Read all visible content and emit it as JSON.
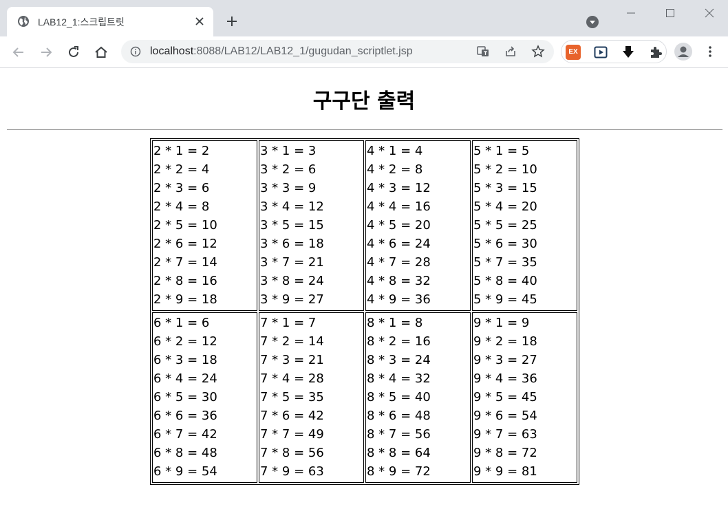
{
  "browser": {
    "tab_title": "LAB12_1:스크립트릿",
    "url_host": "localhost",
    "url_rest": ":8088/LAB12/LAB12_1/gugudan_scriptlet.jsp",
    "extension_badge": "EX"
  },
  "page": {
    "title": "구구단 출력"
  },
  "table": {
    "rows": [
      [
        [
          "2 * 1 = 2",
          "2 * 2 = 4",
          "2 * 3 = 6",
          "2 * 4 = 8",
          "2 * 5 = 10",
          "2 * 6 = 12",
          "2 * 7 = 14",
          "2 * 8 = 16",
          "2 * 9 = 18"
        ],
        [
          "3 * 1 = 3",
          "3 * 2 = 6",
          "3 * 3 = 9",
          "3 * 4 = 12",
          "3 * 5 = 15",
          "3 * 6 = 18",
          "3 * 7 = 21",
          "3 * 8 = 24",
          "3 * 9 = 27"
        ],
        [
          "4 * 1 = 4",
          "4 * 2 = 8",
          "4 * 3 = 12",
          "4 * 4 = 16",
          "4 * 5 = 20",
          "4 * 6 = 24",
          "4 * 7 = 28",
          "4 * 8 = 32",
          "4 * 9 = 36"
        ],
        [
          "5 * 1 = 5",
          "5 * 2 = 10",
          "5 * 3 = 15",
          "5 * 4 = 20",
          "5 * 5 = 25",
          "5 * 6 = 30",
          "5 * 7 = 35",
          "5 * 8 = 40",
          "5 * 9 = 45"
        ]
      ],
      [
        [
          "6 * 1 = 6",
          "6 * 2 = 12",
          "6 * 3 = 18",
          "6 * 4 = 24",
          "6 * 5 = 30",
          "6 * 6 = 36",
          "6 * 7 = 42",
          "6 * 8 = 48",
          "6 * 9 = 54"
        ],
        [
          "7 * 1 = 7",
          "7 * 2 = 14",
          "7 * 3 = 21",
          "7 * 4 = 28",
          "7 * 5 = 35",
          "7 * 6 = 42",
          "7 * 7 = 49",
          "7 * 8 = 56",
          "7 * 9 = 63"
        ],
        [
          "8 * 1 = 8",
          "8 * 2 = 16",
          "8 * 3 = 24",
          "8 * 4 = 32",
          "8 * 5 = 40",
          "8 * 6 = 48",
          "8 * 7 = 56",
          "8 * 8 = 64",
          "8 * 9 = 72"
        ],
        [
          "9 * 1 = 9",
          "9 * 2 = 18",
          "9 * 3 = 27",
          "9 * 4 = 36",
          "9 * 5 = 45",
          "9 * 6 = 54",
          "9 * 7 = 63",
          "9 * 8 = 72",
          "9 * 9 = 81"
        ]
      ]
    ]
  }
}
